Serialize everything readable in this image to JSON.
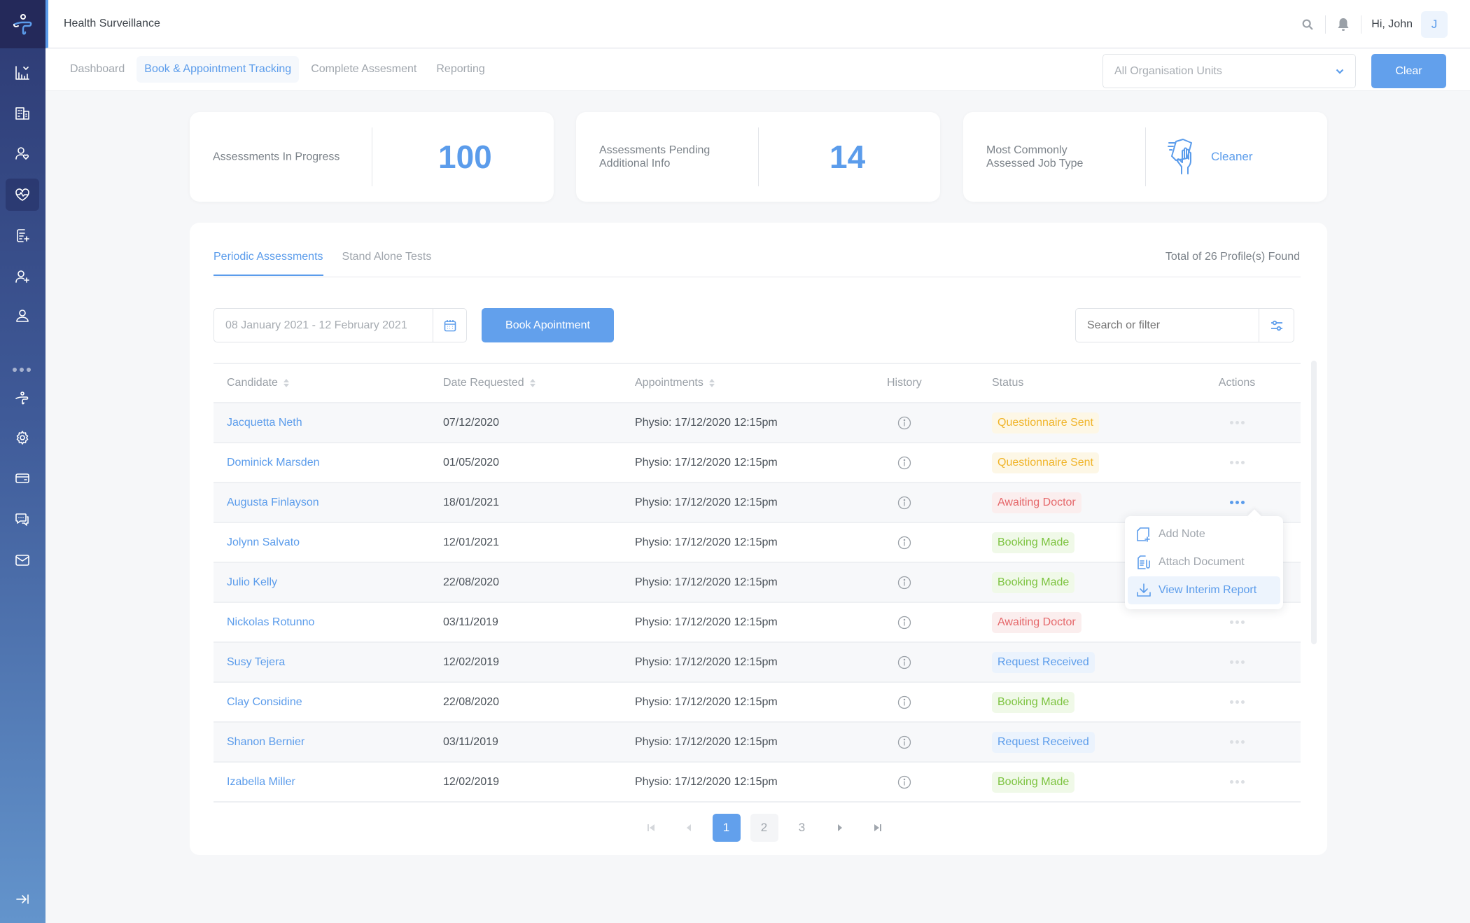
{
  "header": {
    "app_title": "Health Surveillance",
    "greeting": "Hi, John",
    "avatar_initial": "J",
    "icons": [
      "search-icon",
      "bell-icon"
    ]
  },
  "sidebar": {
    "items": [
      {
        "icon": "analytics-icon",
        "active": false
      },
      {
        "icon": "buildings-icon",
        "active": false
      },
      {
        "icon": "user-heart-icon",
        "active": false
      },
      {
        "icon": "heartbeat-icon",
        "active": true
      },
      {
        "icon": "add-document-icon",
        "active": false
      },
      {
        "icon": "add-user-icon",
        "active": false
      },
      {
        "icon": "user-refresh-icon",
        "active": false
      },
      {
        "icon": "more-dots-icon",
        "active": false
      },
      {
        "icon": "app-logo-icon",
        "active": false
      },
      {
        "icon": "settings-icon",
        "active": false
      },
      {
        "icon": "card-icon",
        "active": false
      },
      {
        "icon": "chat-icon",
        "active": false
      },
      {
        "icon": "mail-icon",
        "active": false
      }
    ],
    "collapse_icon": "expand-arrow-icon"
  },
  "subnav": {
    "tabs": [
      {
        "label": "Dashboard",
        "active": false
      },
      {
        "label": "Book & Appointment Tracking",
        "active": true
      },
      {
        "label": "Complete Assesment",
        "active": false
      },
      {
        "label": "Reporting",
        "active": false
      }
    ],
    "org_select": {
      "value": "All Organisation Units"
    },
    "clear_label": "Clear"
  },
  "stats": [
    {
      "label": "Assessments In Progress",
      "value": "100"
    },
    {
      "label_line1": "Assessments Pending",
      "label_line2": "Additional Info",
      "value": "14"
    },
    {
      "label_line1": "Most Commonly",
      "label_line2": "Assessed Job Type",
      "value": "Cleaner",
      "icon": "cleaning-hand-icon"
    }
  ],
  "panel": {
    "tabs": [
      {
        "label": "Periodic Assessments",
        "active": true
      },
      {
        "label": "Stand Alone Tests",
        "active": false
      }
    ],
    "total_text": "Total of 26 Profile(s) Found",
    "date_range": {
      "value": "08 January 2021 - 12 February 2021"
    },
    "book_label": "Book Apointment",
    "search": {
      "placeholder": "Search or filter"
    },
    "columns": [
      "Candidate",
      "Date Requested",
      "Appointments",
      "History",
      "Status",
      "Actions"
    ],
    "rows": [
      {
        "candidate": "Jacquetta Neth",
        "date": "07/12/2020",
        "appointment": "Physio: 17/12/2020 12:15pm",
        "status": "Questionnaire Sent",
        "status_color": "yellow"
      },
      {
        "candidate": "Dominick Marsden",
        "date": "01/05/2020",
        "appointment": "Physio: 17/12/2020 12:15pm",
        "status": "Questionnaire Sent",
        "status_color": "yellow"
      },
      {
        "candidate": "Augusta Finlayson",
        "date": "18/01/2021",
        "appointment": "Physio: 17/12/2020 12:15pm",
        "status": "Awaiting Doctor",
        "status_color": "red",
        "menu_open": true
      },
      {
        "candidate": "Jolynn Salvato",
        "date": "12/01/2021",
        "appointment": "Physio: 17/12/2020 12:15pm",
        "status": "Booking Made",
        "status_color": "green"
      },
      {
        "candidate": "Julio Kelly",
        "date": "22/08/2020",
        "appointment": "Physio: 17/12/2020 12:15pm",
        "status": "Booking Made",
        "status_color": "green"
      },
      {
        "candidate": "Nickolas Rotunno",
        "date": "03/11/2019",
        "appointment": "Physio: 17/12/2020 12:15pm",
        "status": "Awaiting Doctor",
        "status_color": "red"
      },
      {
        "candidate": "Susy Tejera",
        "date": "12/02/2019",
        "appointment": "Physio: 17/12/2020 12:15pm",
        "status": "Request Received",
        "status_color": "blue"
      },
      {
        "candidate": "Clay Considine",
        "date": "22/08/2020",
        "appointment": "Physio: 17/12/2020 12:15pm",
        "status": "Booking Made",
        "status_color": "green"
      },
      {
        "candidate": "Shanon Bernier",
        "date": "03/11/2019",
        "appointment": "Physio: 17/12/2020 12:15pm",
        "status": "Request Received",
        "status_color": "blue"
      },
      {
        "candidate": "Izabella Miller",
        "date": "12/02/2019",
        "appointment": "Physio: 17/12/2020 12:15pm",
        "status": "Booking Made",
        "status_color": "green"
      }
    ],
    "action_menu": [
      {
        "label": "Add Note",
        "icon": "add-note-icon",
        "highlighted": false
      },
      {
        "label": "Attach Document",
        "icon": "attach-document-icon",
        "highlighted": false
      },
      {
        "label": "View Interim Report",
        "icon": "download-icon",
        "highlighted": true
      }
    ],
    "pagination": {
      "pages": [
        "1",
        "2",
        "3"
      ],
      "current": "1"
    }
  },
  "colors": {
    "accent": "#5b9ceb",
    "yellow": "#f0b429",
    "red": "#e5676a",
    "green": "#7cc33f",
    "blue": "#5b9ceb"
  }
}
